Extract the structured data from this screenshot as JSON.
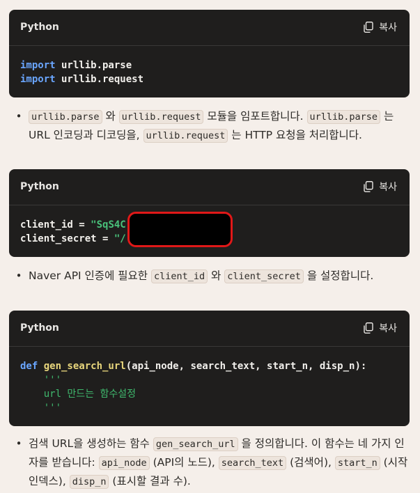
{
  "blocks": [
    {
      "language": "Python",
      "copy_label": "복사",
      "lines": [
        [
          {
            "t": "import",
            "c": "kw"
          },
          {
            "t": " urllib.parse",
            "c": ""
          }
        ],
        [
          {
            "t": "import",
            "c": "kw"
          },
          {
            "t": " urllib.request",
            "c": ""
          }
        ]
      ]
    },
    {
      "language": "Python",
      "copy_label": "복사",
      "lines": [
        [
          {
            "t": "client_id = ",
            "c": ""
          },
          {
            "t": "\"SqS4C",
            "c": "str"
          }
        ],
        [
          {
            "t": "client_secret = ",
            "c": ""
          },
          {
            "t": "\"/",
            "c": "str"
          }
        ]
      ]
    },
    {
      "language": "Python",
      "copy_label": "복사",
      "lines": [
        [
          {
            "t": "def ",
            "c": "kw"
          },
          {
            "t": "gen_search_url",
            "c": "fn"
          },
          {
            "t": "(api_node, search_text, start_n, disp_n):",
            "c": ""
          }
        ],
        [
          {
            "t": "    '''",
            "c": "doc"
          }
        ],
        [
          {
            "t": "    url 만드는 함수설정",
            "c": "doc"
          }
        ],
        [
          {
            "t": "    '''",
            "c": "doc"
          }
        ]
      ]
    }
  ],
  "bullets": [
    [
      {
        "t": "urllib.parse",
        "code": true
      },
      {
        "t": " 와 "
      },
      {
        "t": "urllib.request",
        "code": true
      },
      {
        "t": " 모듈을 임포트합니다. "
      },
      {
        "t": "urllib.parse",
        "code": true
      },
      {
        "t": " 는 URL 인코딩과 디코딩을, "
      },
      {
        "t": "urllib.request",
        "code": true
      },
      {
        "t": " 는 HTTP 요청을 처리합니다."
      }
    ],
    [
      {
        "t": "Naver API 인증에 필요한 "
      },
      {
        "t": "client_id",
        "code": true
      },
      {
        "t": " 와 "
      },
      {
        "t": "client_secret",
        "code": true
      },
      {
        "t": " 을 설정합니다."
      }
    ],
    [
      {
        "t": "검색 URL을 생성하는 함수 "
      },
      {
        "t": "gen_search_url",
        "code": true
      },
      {
        "t": " 을 정의합니다. 이 함수는 네 가지 인자를 받습니다: "
      },
      {
        "t": "api_node",
        "code": true
      },
      {
        "t": " (API의 노드), "
      },
      {
        "t": "search_text",
        "code": true
      },
      {
        "t": " (검색어), "
      },
      {
        "t": "start_n",
        "code": true
      },
      {
        "t": " (시작 인덱스), "
      },
      {
        "t": "disp_n",
        "code": true
      },
      {
        "t": " (표시할 결과 수)."
      }
    ]
  ],
  "icons": {
    "copy": "copy-icon"
  }
}
